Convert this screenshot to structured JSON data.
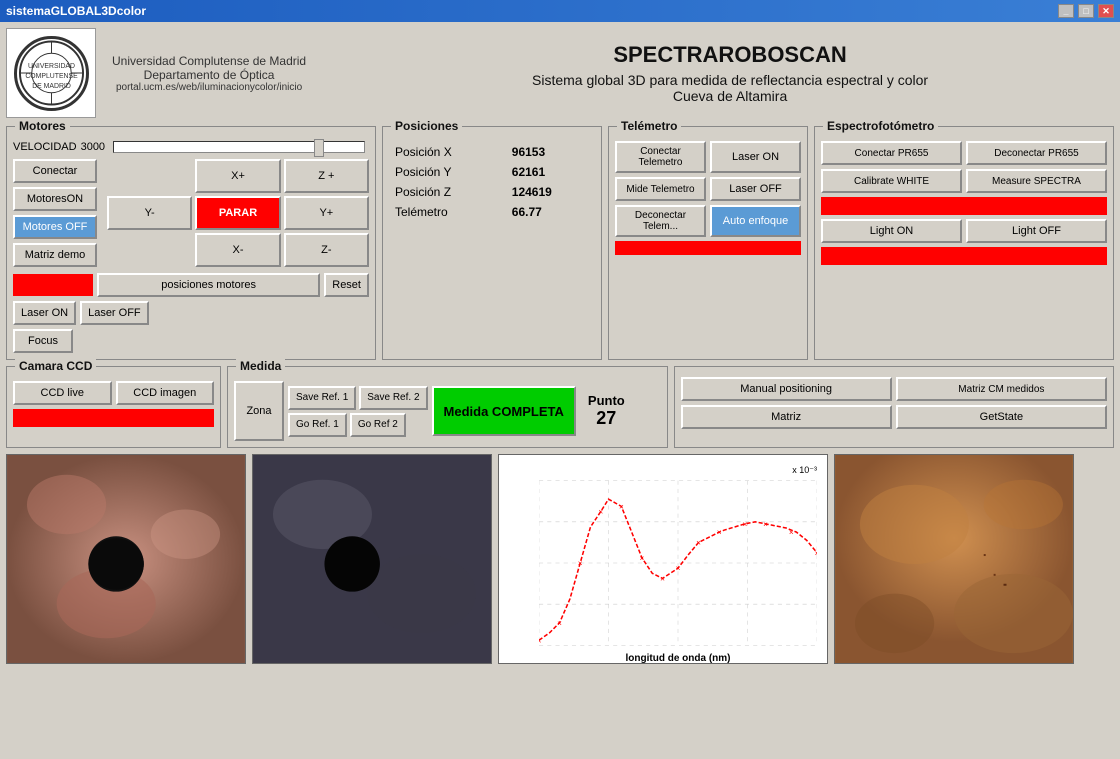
{
  "window": {
    "title": "sistemaGLOBAL3Dcolor"
  },
  "header": {
    "logo_text": "UCM",
    "uni_line1": "Universidad Complutense de Madrid",
    "uni_line2": "Departamento de Óptica",
    "uni_line3": "portal.ucm.es/web/iluminacionycolor/inicio",
    "app_title": "SPECTRAROBOSCAN",
    "subtitle1": "Sistema global 3D para medida de reflectancia espectral y color",
    "subtitle2": "Cueva de Altamira"
  },
  "motores": {
    "panel_title": "Motores",
    "velocidad_label": "VELOCIDAD",
    "velocidad_value": "3000",
    "conectar": "Conectar",
    "motores_on": "MotoresON",
    "motores_off": "Motores OFF",
    "matriz_demo": "Matriz demo",
    "xplus": "X+",
    "xminus": "X-",
    "yplus": "Y+",
    "yminus": "Y-",
    "zplus": "Z +",
    "zminus": "Z-",
    "parar": "PARAR",
    "posiciones": "posiciones motores",
    "reset": "Reset",
    "laser_on": "Laser ON",
    "laser_off": "Laser OFF",
    "focus": "Focus"
  },
  "posiciones": {
    "panel_title": "Posiciones",
    "pos_x_label": "Posición X",
    "pos_x_value": "96153",
    "pos_y_label": "Posición Y",
    "pos_y_value": "62161",
    "pos_z_label": "Posición Z",
    "pos_z_value": "124619",
    "telemetro_label": "Telémetro",
    "telemetro_value": "66.77"
  },
  "telemetro": {
    "panel_title": "Telémetro",
    "conectar": "Conectar Telemetro",
    "laser_on": "Laser ON",
    "mide": "Mide Telemetro",
    "laser_off": "Laser OFF",
    "desconectar": "Deconectar Telem...",
    "auto_enfoque": "Auto enfoque"
  },
  "espectrofotometro": {
    "panel_title": "Espectrofotómetro",
    "conectar": "Conectar PR655",
    "desconectar": "Deconectar PR655",
    "calibrate": "Calibrate WHITE",
    "measure": "Measure SPECTRA",
    "light_on": "Light ON",
    "light_off": "Light OFF"
  },
  "camara": {
    "panel_title": "Camara CCD",
    "ccd_live": "CCD live",
    "ccd_imagen": "CCD imagen"
  },
  "medida": {
    "panel_title": "Medida",
    "zona": "Zona",
    "save_ref1": "Save Ref. 1",
    "save_ref2": "Save Ref. 2",
    "go_ref1": "Go Ref. 1",
    "go_ref2": "Go Ref 2",
    "medida_completa": "Medida COMPLETA",
    "punto_label": "Punto",
    "punto_value": "27"
  },
  "bottom_buttons": {
    "manual_positioning": "Manual positioning",
    "matriz_cm": "Matriz CM medidos",
    "matriz": "Matriz",
    "get_state": "GetState"
  },
  "chart": {
    "x_label": "longitud de onda (nm)",
    "y_label": "x 10⁻³",
    "x_min": 400,
    "x_max": 750,
    "y_min": 0,
    "y_max": 2
  }
}
